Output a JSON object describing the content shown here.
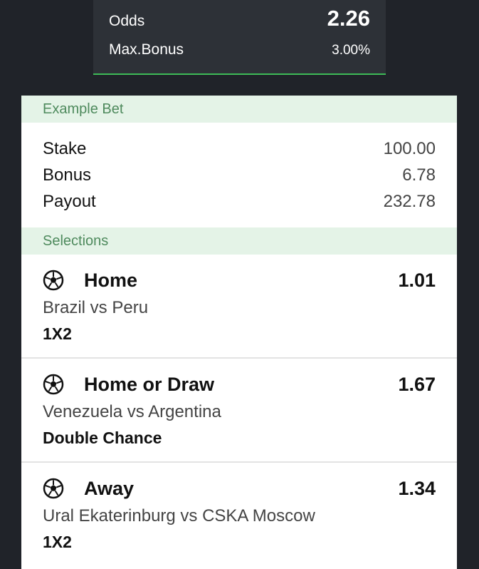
{
  "summary": {
    "odds_label": "Odds",
    "odds_value": "2.26",
    "max_bonus_label": "Max.Bonus",
    "max_bonus_value": "3.00%"
  },
  "example_bet": {
    "header": "Example Bet",
    "rows": [
      {
        "label": "Stake",
        "value": "100.00"
      },
      {
        "label": "Bonus",
        "value": "6.78"
      },
      {
        "label": "Payout",
        "value": "232.78"
      }
    ]
  },
  "selections": {
    "header": "Selections",
    "items": [
      {
        "icon": "soccer-ball-icon",
        "pick": "Home",
        "odds": "1.01",
        "match": "Brazil vs Peru",
        "market": "1X2"
      },
      {
        "icon": "soccer-ball-icon",
        "pick": "Home or Draw",
        "odds": "1.67",
        "match": "Venezuela vs Argentina",
        "market": "Double Chance"
      },
      {
        "icon": "soccer-ball-icon",
        "pick": "Away",
        "odds": "1.34",
        "match": "Ural Ekaterinburg vs CSKA Moscow",
        "market": "1X2"
      }
    ]
  },
  "colors": {
    "background": "#202329",
    "summary_bg": "#2d3137",
    "accent_green": "#3dbb57",
    "section_head_bg": "#e4f3e7",
    "section_head_text": "#4e8a5d"
  }
}
